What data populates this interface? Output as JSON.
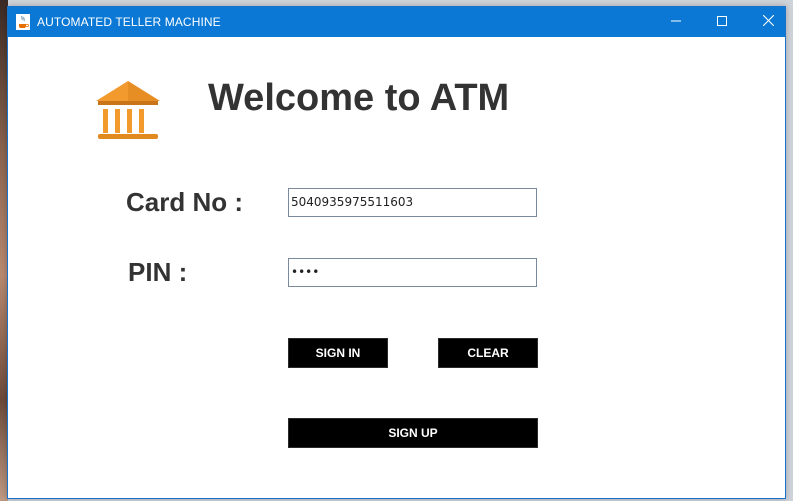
{
  "window": {
    "title": "AUTOMATED TELLER MACHINE",
    "icon": "java-coffee-icon",
    "controls": {
      "minimize_icon": "minimize-icon",
      "maximize_icon": "maximize-icon",
      "close_icon": "close-icon"
    }
  },
  "header": {
    "logo_icon": "bank-building-icon",
    "title": "Welcome to ATM"
  },
  "form": {
    "card_label": "Card No :",
    "card_value": "5040935975511603",
    "pin_label": "PIN :",
    "pin_value": "••••"
  },
  "buttons": {
    "sign_in": "SIGN IN",
    "clear": "CLEAR",
    "sign_up": "SIGN UP"
  },
  "colors": {
    "titlebar": "#0a78d4",
    "logo": "#e8952a",
    "button_bg": "#000000",
    "button_text": "#ffffff",
    "text": "#333333"
  }
}
